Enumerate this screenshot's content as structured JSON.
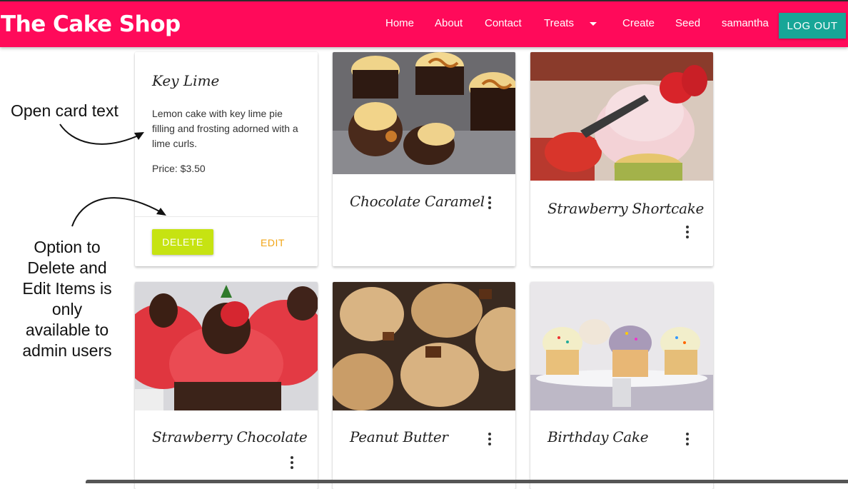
{
  "navbar": {
    "brand": "The Cake Shop",
    "links": [
      "Home",
      "About",
      "Contact",
      "Treats",
      "Create",
      "Seed",
      "samantha"
    ],
    "logout_label": "LOG OUT",
    "bg_color": "#ff0a5a",
    "logout_color": "#17a697"
  },
  "open_card": {
    "title": "Key Lime",
    "description": "Lemon cake with key lime pie filling and frosting adorned with a lime curls.",
    "price": "Price: $3.50",
    "delete_label": "DELETE",
    "edit_label": "EDIT"
  },
  "cards": [
    {
      "title": "Chocolate Caramel",
      "image": "chocolate-cupcakes-with-caramel"
    },
    {
      "title": "Strawberry Shortcake",
      "image": "strawberry-frosted-cupcake"
    },
    {
      "title": "Strawberry Chocolate",
      "image": "red-frosted-cupcakes-with-chocolate-strawberry"
    },
    {
      "title": "Peanut Butter",
      "image": "peanut-butter-frosted-cupcakes"
    },
    {
      "title": "Birthday Cake",
      "image": "sprinkle-cupcakes-on-stand"
    }
  ],
  "annotations": {
    "open_card_text": "Open card text",
    "admin_note": [
      "Option to",
      "Delete and",
      "Edit Items is",
      "only",
      "available to",
      "admin users"
    ]
  }
}
